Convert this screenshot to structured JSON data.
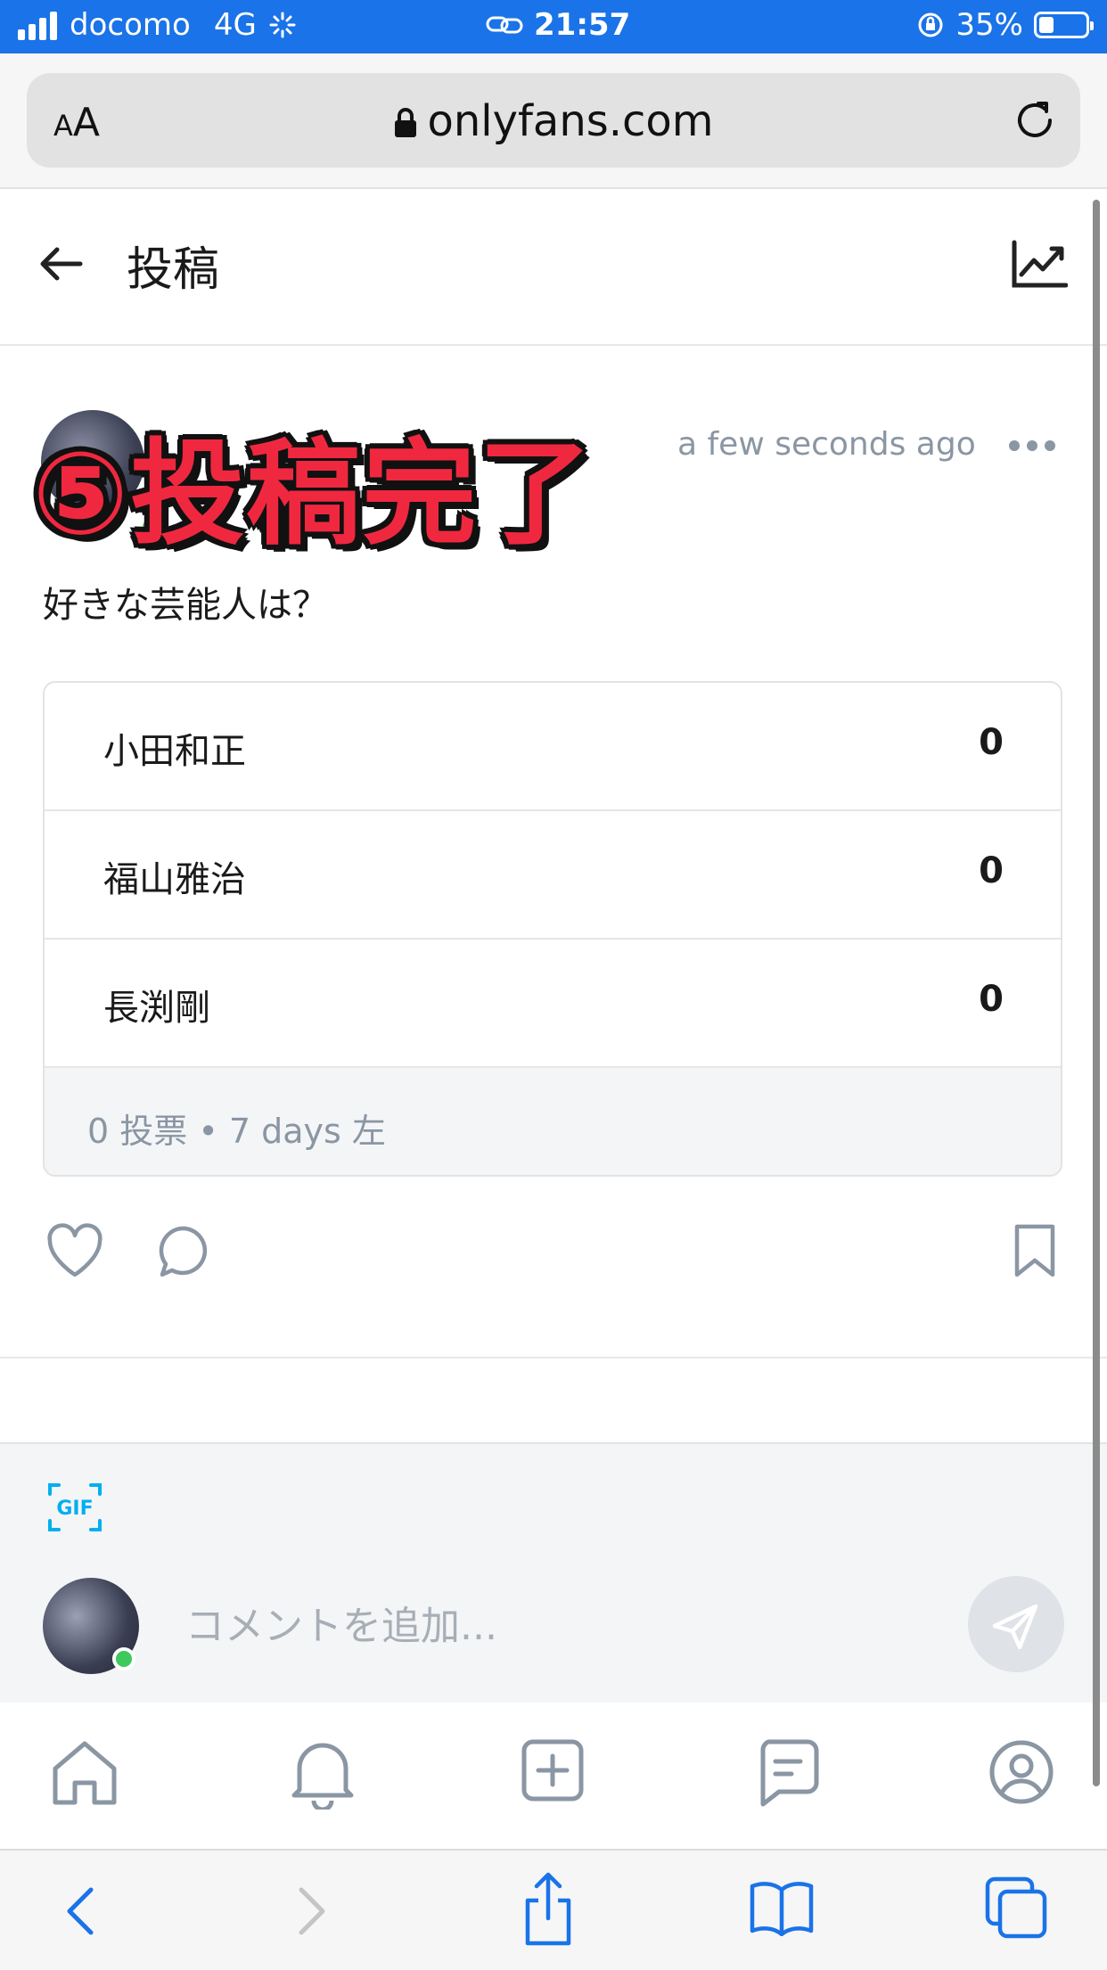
{
  "status_bar": {
    "carrier": "docomo",
    "network": "4G",
    "time": "21:57",
    "battery_percent": "35%",
    "battery_level": 0.35,
    "signal_bars": 4
  },
  "browser": {
    "text_size_label_small": "A",
    "text_size_label_large": "A",
    "url": "onlyfans.com"
  },
  "header": {
    "title": "投稿"
  },
  "post": {
    "overlay_text": "⑤投稿完了",
    "timestamp": "a few seconds ago",
    "question": "好きな芸能人は？",
    "poll": {
      "options": [
        {
          "label": "小田和正",
          "count": "0"
        },
        {
          "label": "福山雅治",
          "count": "0"
        },
        {
          "label": "長渕剛",
          "count": "0"
        }
      ],
      "footer": "0 投票 • 7 days 左"
    }
  },
  "comment": {
    "placeholder": "コメントを追加..."
  },
  "colors": {
    "status_bar": "#1a73e8",
    "accent": "#00aff0",
    "online": "#3ec95c",
    "overlay_red": "#f0283f",
    "muted": "#8a96a3"
  }
}
